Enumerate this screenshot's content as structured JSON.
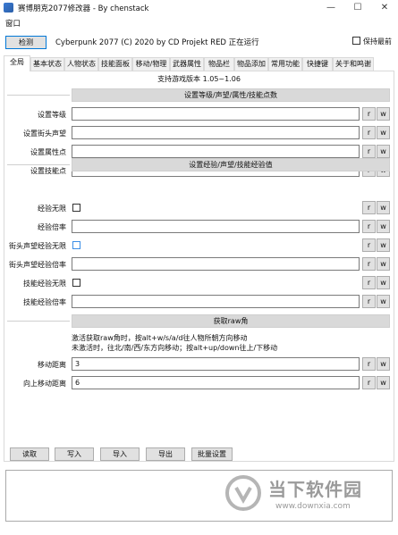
{
  "window": {
    "title": "赛博朋克2077修改器 - By chenstack",
    "minimize": "—",
    "maximize": "☐",
    "close": "✕"
  },
  "menu": {
    "window_label": "窗口"
  },
  "top": {
    "detect_label": "检测",
    "status": "Cyberpunk 2077 (C) 2020 by CD Projekt RED 正在运行",
    "topmost_label": "保持最前"
  },
  "tabs": [
    "全局",
    "基本状态",
    "人物状态",
    "技能面板",
    "移动/物理",
    "武器属性",
    "物品栏",
    "物品添加",
    "常用功能",
    "快捷键",
    "关于和鸣谢"
  ],
  "version_text": "支持游戏版本 1.05~1.06",
  "sections": {
    "level": "设置等级/声望/属性/技能点数",
    "exp": "设置经验/声望/技能经验值",
    "raw": "获取raw角"
  },
  "level_rows": [
    {
      "label": "设置等级",
      "value": ""
    },
    {
      "label": "设置街头声望",
      "value": ""
    },
    {
      "label": "设置属性点",
      "value": ""
    },
    {
      "label": "设置技能点",
      "value": ""
    }
  ],
  "exp_rows": [
    {
      "label": "经验无限",
      "kind": "check"
    },
    {
      "label": "经验倍率",
      "kind": "field",
      "value": ""
    },
    {
      "label": "街头声望经验无限",
      "kind": "check"
    },
    {
      "label": "街头声望经验倍率",
      "kind": "field",
      "value": ""
    },
    {
      "label": "技能经验无限",
      "kind": "check"
    },
    {
      "label": "技能经验倍率",
      "kind": "field",
      "value": ""
    }
  ],
  "raw": {
    "info1": "激活获取raw角时，按alt+w/s/a/d往人物所朝方向移动",
    "info2": "未激活时，往北/南/西/东方向移动；按alt+up/down往上/下移动",
    "rows": [
      {
        "label": "移动距离",
        "value": "3"
      },
      {
        "label": "向上移动距离",
        "value": "6"
      }
    ]
  },
  "row_buttons": {
    "r": "r",
    "w": "w"
  },
  "bottom_buttons": [
    "读取",
    "写入",
    "导入",
    "导出",
    "批量设置"
  ],
  "watermark": {
    "title": "当下软件园",
    "url": "www.downxia.com"
  }
}
